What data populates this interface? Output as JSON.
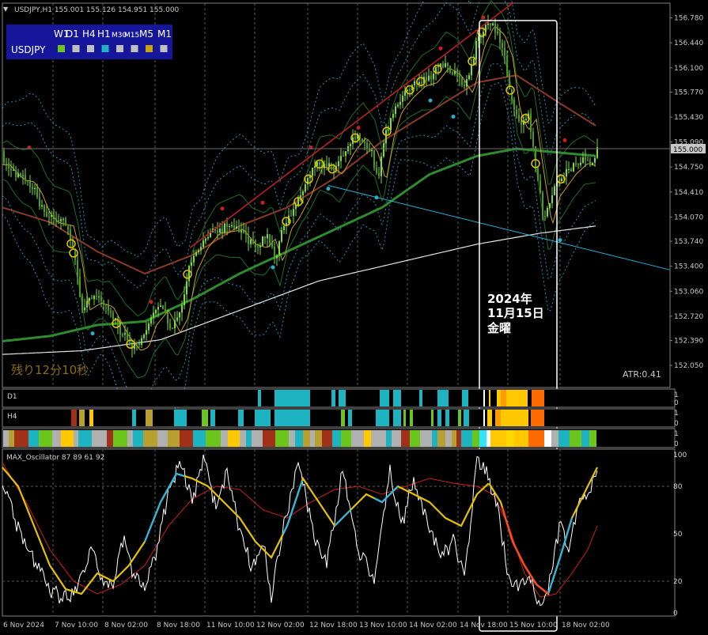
{
  "header": {
    "symbol_info": "USDJPY,H1  155.001 155.126 154.951 155.000"
  },
  "timeframe_panel": {
    "frames": [
      "W1",
      "D1",
      "H4",
      "H1",
      "M30",
      "M15",
      "M5",
      "M1"
    ],
    "symbol": "USDJPY",
    "box_colors": [
      "#6cc51d",
      "#c0c0c0",
      "#c0c0c0",
      "#1eb3c0",
      "#c0c0c0",
      "#c0c0c0",
      "#c9a20d",
      "#c0c0c0"
    ]
  },
  "annotation": {
    "line1": "2024年",
    "line2": "11月15日",
    "line3": "金曜"
  },
  "remaining_time": "残り12分10秒",
  "atr_label": "ATR:0.41",
  "strength_bars": {
    "d1": {
      "label": "D1",
      "scale_top": "1",
      "scale_bottom": "0"
    },
    "h4": {
      "label": "H4",
      "scale_top": "1",
      "scale_bottom": "0"
    },
    "h1": {
      "label": "",
      "scale_top": "1",
      "scale_bottom": "0"
    }
  },
  "oscillator": {
    "title": "MAX_Oscillator 87 89 61 92",
    "levels": [
      "100",
      "80",
      "50",
      "20",
      "0"
    ]
  },
  "colors": {
    "candle": "#7ddc3b",
    "bb_inner": "#1e7a2a",
    "bb_outer": "#2aa3c8",
    "ma_long": "#e6e6e6",
    "ma_mid": "#2e8b2e",
    "ma_brown": "#8b3a2a",
    "trend_red": "#c81e1e",
    "trend_cyan": "#2ab0d8",
    "marker_yellow": "#e6c300",
    "osc_white": "#ffffff",
    "osc_red": "#d21e1e",
    "osc_yellow": "#e6c300",
    "osc_cyan": "#2ab8e6"
  },
  "chart_data": {
    "type": "candlestick",
    "symbol": "USDJPY",
    "timeframe": "H1",
    "price_axis": {
      "ticks": [
        "156.780",
        "156.440",
        "156.100",
        "155.770",
        "155.430",
        "155.090",
        "154.750",
        "154.410",
        "154.070",
        "153.740",
        "153.400",
        "153.060",
        "152.720",
        "152.390",
        "152.050"
      ],
      "current_price": "155.000",
      "ylim": [
        151.75,
        156.98
      ]
    },
    "time_axis": {
      "labels": [
        "6 Nov 2024",
        "7 Nov 10:00",
        "8 Nov 02:00",
        "8 Nov 18:00",
        "11 Nov 10:00",
        "12 Nov 02:00",
        "12 Nov 18:00",
        "13 Nov 10:00",
        "14 Nov 02:00",
        "14 Nov 18:00",
        "15 Nov 10:00",
        "18 Nov 02:00"
      ]
    },
    "close_path": [
      [
        0,
        154.83
      ],
      [
        10,
        154.7
      ],
      [
        20,
        154.62
      ],
      [
        30,
        154.6
      ],
      [
        40,
        154.45
      ],
      [
        50,
        154.18
      ],
      [
        60,
        154.05
      ],
      [
        70,
        154.02
      ],
      [
        80,
        154.0
      ],
      [
        90,
        153.58
      ],
      [
        100,
        152.85
      ],
      [
        115,
        152.95
      ],
      [
        130,
        152.9
      ],
      [
        150,
        152.5
      ],
      [
        165,
        152.3
      ],
      [
        175,
        152.35
      ],
      [
        185,
        152.65
      ],
      [
        200,
        152.85
      ],
      [
        215,
        152.55
      ],
      [
        225,
        152.75
      ],
      [
        235,
        153.35
      ],
      [
        250,
        153.7
      ],
      [
        265,
        153.9
      ],
      [
        280,
        153.92
      ],
      [
        295,
        153.95
      ],
      [
        310,
        153.75
      ],
      [
        325,
        153.7
      ],
      [
        335,
        153.82
      ],
      [
        345,
        153.5
      ],
      [
        355,
        153.95
      ],
      [
        365,
        154.1
      ],
      [
        380,
        154.4
      ],
      [
        395,
        154.8
      ],
      [
        410,
        154.78
      ],
      [
        420,
        154.7
      ],
      [
        435,
        155.0
      ],
      [
        450,
        155.2
      ],
      [
        465,
        155.0
      ],
      [
        475,
        154.6
      ],
      [
        485,
        155.2
      ],
      [
        495,
        155.55
      ],
      [
        510,
        155.75
      ],
      [
        525,
        155.9
      ],
      [
        540,
        155.95
      ],
      [
        555,
        156.15
      ],
      [
        570,
        156.05
      ],
      [
        585,
        155.8
      ],
      [
        600,
        156.45
      ],
      [
        612,
        156.72
      ],
      [
        625,
        156.6
      ],
      [
        635,
        156.3
      ],
      [
        645,
        155.55
      ],
      [
        655,
        155.3
      ],
      [
        665,
        155.45
      ],
      [
        675,
        154.7
      ],
      [
        685,
        154.0
      ],
      [
        695,
        154.4
      ],
      [
        705,
        154.55
      ],
      [
        715,
        154.7
      ],
      [
        730,
        154.85
      ],
      [
        745,
        154.8
      ],
      [
        752,
        155.0
      ]
    ],
    "ma_long": [
      [
        0,
        152.2
      ],
      [
        100,
        152.25
      ],
      [
        200,
        152.4
      ],
      [
        300,
        152.8
      ],
      [
        400,
        153.2
      ],
      [
        500,
        153.45
      ],
      [
        600,
        153.7
      ],
      [
        680,
        153.85
      ],
      [
        752,
        153.95
      ]
    ],
    "ma_mid": [
      [
        0,
        152.38
      ],
      [
        60,
        152.45
      ],
      [
        120,
        152.6
      ],
      [
        180,
        152.65
      ],
      [
        240,
        152.95
      ],
      [
        300,
        153.3
      ],
      [
        360,
        153.6
      ],
      [
        420,
        153.9
      ],
      [
        480,
        154.2
      ],
      [
        540,
        154.65
      ],
      [
        600,
        154.9
      ],
      [
        650,
        155.0
      ],
      [
        700,
        154.95
      ],
      [
        752,
        154.9
      ]
    ],
    "ma_brown": [
      [
        0,
        154.2
      ],
      [
        60,
        154.0
      ],
      [
        120,
        153.6
      ],
      [
        180,
        153.3
      ],
      [
        240,
        153.55
      ],
      [
        300,
        153.95
      ],
      [
        360,
        154.2
      ],
      [
        420,
        154.6
      ],
      [
        480,
        155.1
      ],
      [
        540,
        155.5
      ],
      [
        600,
        155.9
      ],
      [
        650,
        156.0
      ],
      [
        700,
        155.65
      ],
      [
        752,
        155.3
      ]
    ],
    "trendlines": {
      "red": {
        "from": [
          "6 Nov 2024",
          153.2
        ],
        "to": [
          "14 Nov 18:00",
          157.0
        ]
      },
      "cyan": {
        "from": [
          "12 Nov 18:00",
          154.5
        ],
        "to": [
          "18 Nov 02:00",
          153.6
        ]
      }
    },
    "highlight_window": {
      "start": "14 Nov 18:00",
      "end": "15 Nov 10:00"
    },
    "oscillator_ylim": [
      0,
      100
    ],
    "oscillator_white": [
      [
        0,
        85
      ],
      [
        15,
        60
      ],
      [
        30,
        40
      ],
      [
        45,
        30
      ],
      [
        60,
        15
      ],
      [
        75,
        10
      ],
      [
        90,
        12
      ],
      [
        105,
        30
      ],
      [
        115,
        45
      ],
      [
        125,
        20
      ],
      [
        140,
        18
      ],
      [
        155,
        50
      ],
      [
        165,
        25
      ],
      [
        180,
        15
      ],
      [
        195,
        40
      ],
      [
        210,
        75
      ],
      [
        225,
        95
      ],
      [
        240,
        70
      ],
      [
        255,
        98
      ],
      [
        270,
        65
      ],
      [
        285,
        90
      ],
      [
        300,
        50
      ],
      [
        315,
        30
      ],
      [
        330,
        45
      ],
      [
        340,
        10
      ],
      [
        355,
        55
      ],
      [
        375,
        95
      ],
      [
        395,
        45
      ],
      [
        410,
        30
      ],
      [
        430,
        90
      ],
      [
        450,
        40
      ],
      [
        470,
        20
      ],
      [
        490,
        90
      ],
      [
        505,
        55
      ],
      [
        520,
        85
      ],
      [
        535,
        60
      ],
      [
        555,
        35
      ],
      [
        570,
        45
      ],
      [
        585,
        25
      ],
      [
        600,
        95
      ],
      [
        612,
        88
      ],
      [
        625,
        70
      ],
      [
        640,
        20
      ],
      [
        655,
        15
      ],
      [
        665,
        25
      ],
      [
        675,
        10
      ],
      [
        685,
        5
      ],
      [
        695,
        30
      ],
      [
        705,
        55
      ],
      [
        715,
        40
      ],
      [
        730,
        70
      ],
      [
        745,
        80
      ],
      [
        752,
        92
      ]
    ],
    "oscillator_red": [
      [
        0,
        95
      ],
      [
        30,
        70
      ],
      [
        60,
        40
      ],
      [
        90,
        20
      ],
      [
        120,
        12
      ],
      [
        150,
        18
      ],
      [
        180,
        30
      ],
      [
        210,
        55
      ],
      [
        240,
        72
      ],
      [
        270,
        80
      ],
      [
        300,
        78
      ],
      [
        330,
        65
      ],
      [
        360,
        60
      ],
      [
        390,
        70
      ],
      [
        420,
        78
      ],
      [
        450,
        80
      ],
      [
        480,
        75
      ],
      [
        510,
        80
      ],
      [
        540,
        85
      ],
      [
        570,
        82
      ],
      [
        600,
        80
      ],
      [
        620,
        75
      ],
      [
        640,
        55
      ],
      [
        660,
        25
      ],
      [
        680,
        10
      ],
      [
        700,
        12
      ],
      [
        720,
        25
      ],
      [
        740,
        40
      ],
      [
        752,
        55
      ]
    ],
    "oscillator_yellow": [
      [
        0,
        92
      ],
      [
        20,
        80
      ],
      [
        40,
        55
      ],
      [
        60,
        30
      ],
      [
        80,
        15
      ],
      [
        100,
        12
      ],
      [
        120,
        25
      ],
      [
        140,
        20
      ],
      [
        160,
        30
      ],
      [
        180,
        45
      ],
      [
        200,
        70
      ],
      [
        220,
        88
      ],
      [
        240,
        85
      ],
      [
        260,
        80
      ],
      [
        280,
        70
      ],
      [
        300,
        60
      ],
      [
        320,
        45
      ],
      [
        340,
        35
      ],
      [
        360,
        55
      ],
      [
        380,
        85
      ],
      [
        400,
        70
      ],
      [
        420,
        55
      ],
      [
        440,
        65
      ],
      [
        460,
        75
      ],
      [
        480,
        70
      ],
      [
        500,
        80
      ],
      [
        520,
        75
      ],
      [
        540,
        70
      ],
      [
        560,
        60
      ],
      [
        580,
        55
      ],
      [
        600,
        75
      ],
      [
        615,
        82
      ],
      [
        630,
        70
      ],
      [
        645,
        45
      ],
      [
        660,
        30
      ],
      [
        675,
        18
      ],
      [
        690,
        12
      ],
      [
        705,
        35
      ],
      [
        720,
        60
      ],
      [
        735,
        75
      ],
      [
        752,
        92
      ]
    ]
  }
}
